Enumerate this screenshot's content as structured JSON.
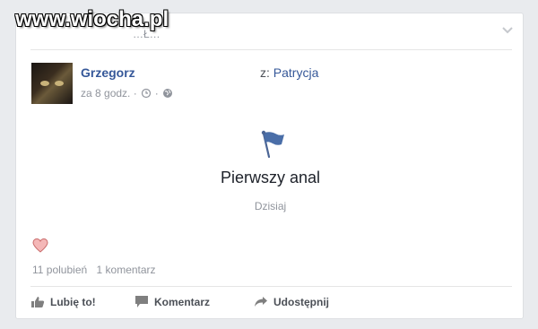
{
  "watermark": "www.wiocha.pl",
  "top_hidden_text": "…Ł…",
  "post": {
    "author": "Grzegorz",
    "with_prefix": "z:",
    "with_name": "Patrycja",
    "time": "za 8 godz. ·",
    "separator": "·"
  },
  "event": {
    "title": "Pierwszy anal",
    "date": "Dzisiaj",
    "icon": "flag-icon"
  },
  "reactions": {
    "icon": "heart-icon",
    "likes": "11 polubień",
    "comments": "1 komentarz"
  },
  "actions": {
    "like": "Lubię to!",
    "comment": "Komentarz",
    "share": "Udostępnij"
  },
  "colors": {
    "link": "#365899",
    "muted": "#90949c",
    "flag": "#4267b2",
    "heart": "#f0a0a0"
  }
}
